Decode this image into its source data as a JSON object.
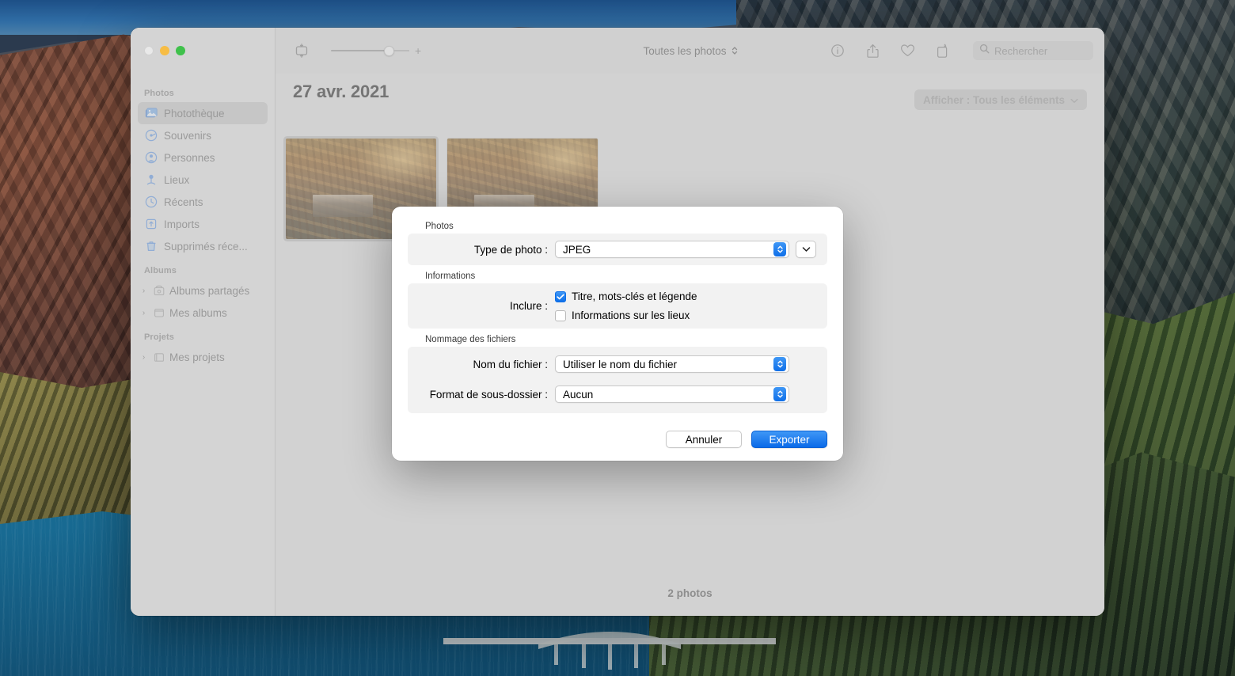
{
  "window": {
    "traffic_lights": [
      "close",
      "minimize",
      "maximize"
    ]
  },
  "toolbar": {
    "view_mode_label": "Toutes les photos",
    "zoom_plus": "+",
    "icons": [
      "aspect-icon",
      "info-icon",
      "share-icon",
      "favorite-icon",
      "rotate-icon"
    ],
    "search": {
      "placeholder": "Rechercher"
    }
  },
  "sidebar": {
    "sections": [
      {
        "title": "Photos",
        "items": [
          {
            "label": "Photothèque",
            "icon": "photo-library-icon",
            "selected": true
          },
          {
            "label": "Souvenirs",
            "icon": "memories-icon",
            "selected": false
          },
          {
            "label": "Personnes",
            "icon": "people-icon",
            "selected": false
          },
          {
            "label": "Lieux",
            "icon": "places-pin-icon",
            "selected": false
          },
          {
            "label": "Récents",
            "icon": "clock-icon",
            "selected": false
          },
          {
            "label": "Imports",
            "icon": "import-icon",
            "selected": false
          },
          {
            "label": "Supprimés réce...",
            "icon": "trash-icon",
            "selected": false
          }
        ]
      },
      {
        "title": "Albums",
        "items": [
          {
            "label": "Albums partagés",
            "icon": "shared-album-icon",
            "disclosure": "›"
          },
          {
            "label": "Mes albums",
            "icon": "album-icon",
            "disclosure": "›"
          }
        ]
      },
      {
        "title": "Projets",
        "items": [
          {
            "label": "Mes projets",
            "icon": "project-icon",
            "disclosure": "›"
          }
        ]
      }
    ]
  },
  "content": {
    "filter_button": "Afficher : Tous les éléments",
    "date_heading": "27 avr. 2021",
    "photos": [
      {
        "alt": "Cabane en automne près d'un étang",
        "selected": true
      },
      {
        "alt": "Forêt d'automne",
        "selected": false
      }
    ],
    "status": "2 photos"
  },
  "export_sheet": {
    "groups": [
      {
        "title": "Photos",
        "rows": [
          {
            "label": "Type de photo :",
            "value": "JPEG",
            "has_disclosure": true
          }
        ]
      },
      {
        "title": "Informations",
        "checkbox_label": "Inclure :",
        "checkboxes": [
          {
            "label": "Titre, mots-clés et légende",
            "checked": true
          },
          {
            "label": "Informations sur les lieux",
            "checked": false
          }
        ]
      },
      {
        "title": "Nommage des fichiers",
        "rows": [
          {
            "label": "Nom du fichier :",
            "value": "Utiliser le nom du fichier",
            "has_disclosure": false
          },
          {
            "label": "Format de sous-dossier :",
            "value": "Aucun",
            "has_disclosure": false
          }
        ]
      }
    ],
    "cancel_button": "Annuler",
    "export_button": "Exporter"
  },
  "colors": {
    "accent_blue": "#0a6ae8",
    "window_bg": "#d2d2d2",
    "sidebar_bg": "#d4d4d4",
    "sheet_bg": "#ffffff",
    "group_bg": "#f2f2f2",
    "traffic_yellow": "#f7bd45",
    "traffic_green": "#3fc14b"
  }
}
